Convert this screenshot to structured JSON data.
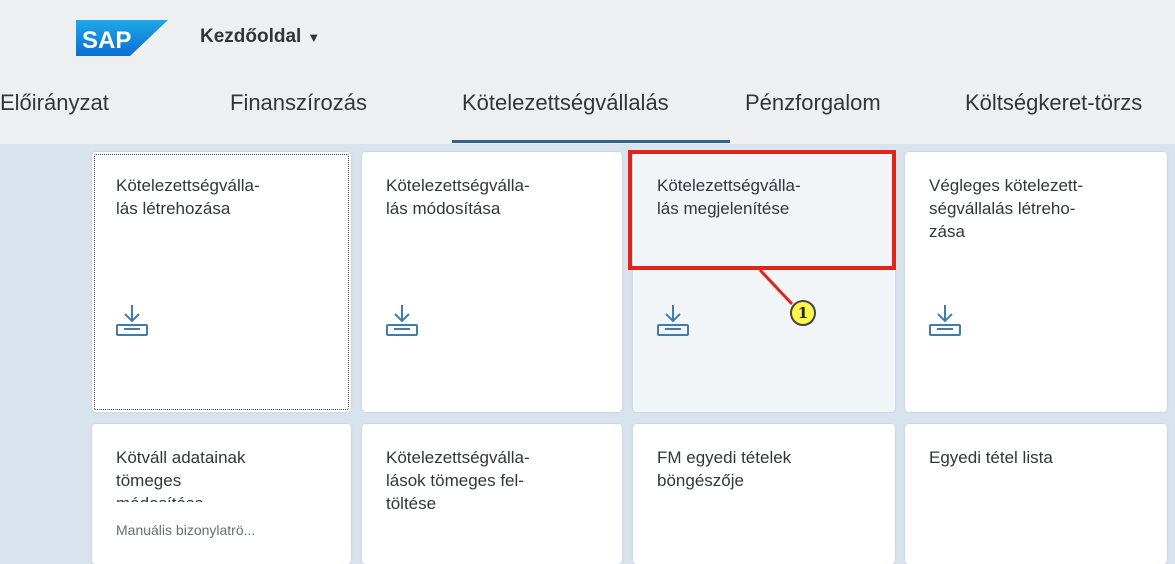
{
  "shell": {
    "brand": "SAP",
    "home_title": "Kezdőoldal",
    "home_caret": "▼"
  },
  "tabs": [
    {
      "label": "Előirányzat"
    },
    {
      "label": "Finanszírozás"
    },
    {
      "label": "Kötelezettségvállalás",
      "selected": true
    },
    {
      "label": "Pénzforgalom"
    },
    {
      "label": "Költségkeret-törzs"
    }
  ],
  "tiles": [
    {
      "title": "Kötelezettségvállalás létrehozása",
      "icon": "download-inbox-icon"
    },
    {
      "title": "Kötelezettségvállalás módosítása",
      "icon": "download-inbox-icon"
    },
    {
      "title": "Kötelezettségvállalás megjelenítése",
      "icon": "download-inbox-icon"
    },
    {
      "title": "Végleges kötelezettségvállalás létrehozása",
      "icon": "download-inbox-icon"
    },
    {
      "title": "Kötvállalás adatainak tömeges módosítása",
      "footer": "Manuális bizonylatrö..."
    },
    {
      "title": "Kötelezettségvállalások tömeges feltöltése"
    },
    {
      "title": "FM egyedi tételek böngészője"
    },
    {
      "title": "Egyedi tétel lista"
    }
  ],
  "tile_titles_display": [
    "Kötelezettségvállalás létrehozása",
    "Kötelezettségvállalás módosítása",
    "Kötelezettségvállalás megjelenítése",
    "Végleges kötelezettségvállalás létrehozása",
    "Kötváll adatainak tömeges módosítása",
    "Kötelezettségvállalások tömeges feltöltése",
    "FM egyedi tételek böngészője",
    "Egyedi tétel lista"
  ],
  "tile_titles_lines": [
    [
      "Kötelezettségválla-",
      "lás létrehozása"
    ],
    [
      "Kötelezettségválla-",
      "lás módosítása"
    ],
    [
      "Kötelezettségválla-",
      "lás megjelenítése"
    ],
    [
      "Végleges kötelezett-",
      "ségvállalás létreho-",
      "zása"
    ],
    [
      "Kötváll adatainak",
      "tömeges",
      "módosítása"
    ],
    [
      "Kötelezettségválla-",
      "lások tömeges fel-",
      "töltése"
    ],
    [
      "FM egyedi tételek",
      "böngészője"
    ],
    [
      "Egyedi tétel lista"
    ]
  ],
  "callout": {
    "number": "1"
  },
  "colors": {
    "highlight": "#e0241b",
    "badge": "#fff84a",
    "tab_underline": "#346187",
    "icon": "#427cac"
  }
}
